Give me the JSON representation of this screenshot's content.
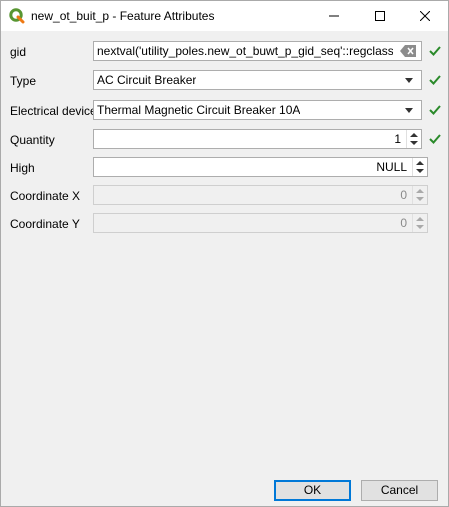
{
  "window": {
    "title": "new_ot_buit_p - Feature Attributes",
    "icon": "qgis-logo-icon",
    "controls": [
      "minimize-icon",
      "maximize-icon",
      "close-icon"
    ]
  },
  "form": {
    "gid": {
      "label": "gid",
      "value": "nextval('utility_poles.new_ot_buwt_p_gid_seq'::regclass)"
    },
    "type": {
      "label": "Type",
      "value": "AC Circuit Breaker"
    },
    "device": {
      "label": "Electrical device",
      "value": "Thermal Magnetic Circuit Breaker 10A"
    },
    "quantity": {
      "label": "Quantity",
      "value": "1"
    },
    "high": {
      "label": "High",
      "value": "NULL"
    },
    "coord_x": {
      "label": "Coordinate X",
      "value": "0"
    },
    "coord_y": {
      "label": "Coordinate Y",
      "value": "0"
    }
  },
  "buttons": {
    "ok": "OK",
    "cancel": "Cancel"
  },
  "colors": {
    "check": "#2a8a2a",
    "default_button_border": "#0078d7",
    "qgis_green": "#589632"
  }
}
